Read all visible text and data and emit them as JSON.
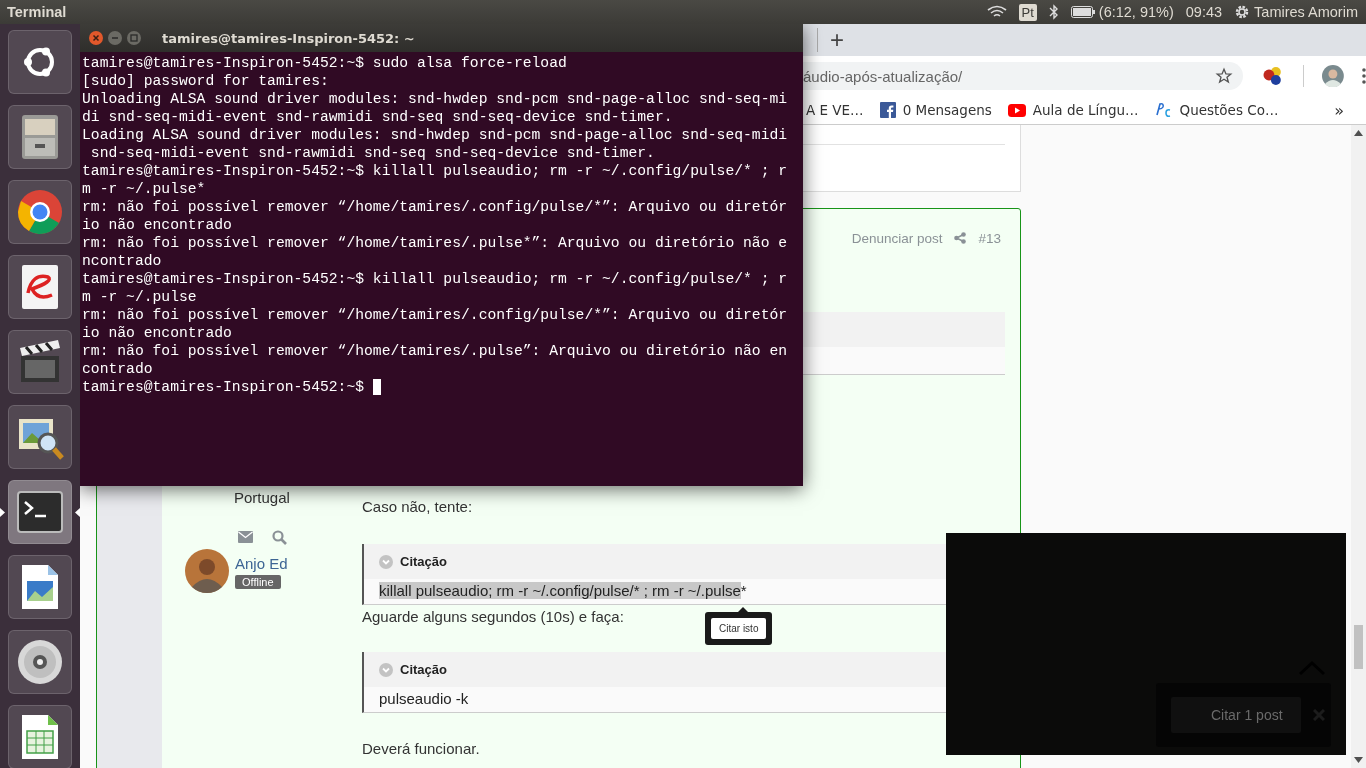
{
  "top_bar": {
    "app_name": "Terminal",
    "keyboard": "Pt",
    "battery": "(6:12, 91%)",
    "clock": "09:43",
    "user": "Tamires Amorim"
  },
  "launcher": [
    {
      "kind": "ubuntu",
      "active": false
    },
    {
      "kind": "files",
      "active": false
    },
    {
      "kind": "chrome",
      "active": false
    },
    {
      "kind": "reader",
      "active": false
    },
    {
      "kind": "video",
      "active": false
    },
    {
      "kind": "viewer",
      "active": false
    },
    {
      "kind": "terminal",
      "active": true
    },
    {
      "kind": "impress",
      "active": false
    },
    {
      "kind": "disc",
      "active": false
    },
    {
      "kind": "calc",
      "active": false
    }
  ],
  "terminal": {
    "title": "tamires@tamires-Inspiron-5452: ~",
    "lines": [
      "tamires@tamires-Inspiron-5452:~$ sudo alsa force-reload",
      "[sudo] password for tamires:",
      "Unloading ALSA sound driver modules: snd-hwdep snd-pcm snd-page-alloc snd-seq-mi",
      "di snd-seq-midi-event snd-rawmidi snd-seq snd-seq-device snd-timer.",
      "Loading ALSA sound driver modules: snd-hwdep snd-pcm snd-page-alloc snd-seq-midi",
      " snd-seq-midi-event snd-rawmidi snd-seq snd-seq-device snd-timer.",
      "tamires@tamires-Inspiron-5452:~$ killall pulseaudio; rm -r ~/.config/pulse/* ; r",
      "m -r ~/.pulse*",
      "rm: não foi possível remover “/home/tamires/.config/pulse/*”: Arquivo ou diretór",
      "io não encontrado",
      "rm: não foi possível remover “/home/tamires/.pulse*”: Arquivo ou diretório não e",
      "ncontrado",
      "tamires@tamires-Inspiron-5452:~$ killall pulseaudio; rm -r ~/.config/pulse/* ; r",
      "m -r ~/.pulse",
      "rm: não foi possível remover “/home/tamires/.config/pulse/*”: Arquivo ou diretór",
      "io não encontrado",
      "rm: não foi possível remover “/home/tamires/.pulse”: Arquivo ou diretório não en",
      "contrado"
    ],
    "prompt": "tamires@tamires-Inspiron-5452:~$ "
  },
  "browser": {
    "new_tab": "+",
    "address": "áudio-após-atualização/",
    "bookmarks": [
      {
        "kind": "plain",
        "label": "A E VE…"
      },
      {
        "kind": "facebook",
        "label": "0 Mensagens"
      },
      {
        "kind": "youtube",
        "label": "Aula de Língu…"
      },
      {
        "kind": "pc",
        "label": "Questões Co…"
      }
    ],
    "more": "»"
  },
  "post": {
    "report": "Denunciar post",
    "number": "#13",
    "location": "Portugal",
    "user": {
      "name": "Anjo Ed",
      "status": "Offline"
    },
    "content": [
      {
        "kind": "text",
        "text": "Caso não, tente:"
      },
      {
        "kind": "quote",
        "title": "Citação",
        "selected_text": "killall pulseaudio; rm -r ~/.config/pulse/* ; rm -r ~/.pulse",
        "text": "*",
        "tooltip": "Citar isto"
      },
      {
        "kind": "text",
        "text": "Aguarde alguns segundos (10s) e faça:"
      },
      {
        "kind": "quote",
        "title": "Citação",
        "text": "pulseaudio -k"
      },
      {
        "kind": "text",
        "text": "Deverá funcionar."
      }
    ]
  },
  "overlay": {
    "button": "Citar 1 post"
  }
}
